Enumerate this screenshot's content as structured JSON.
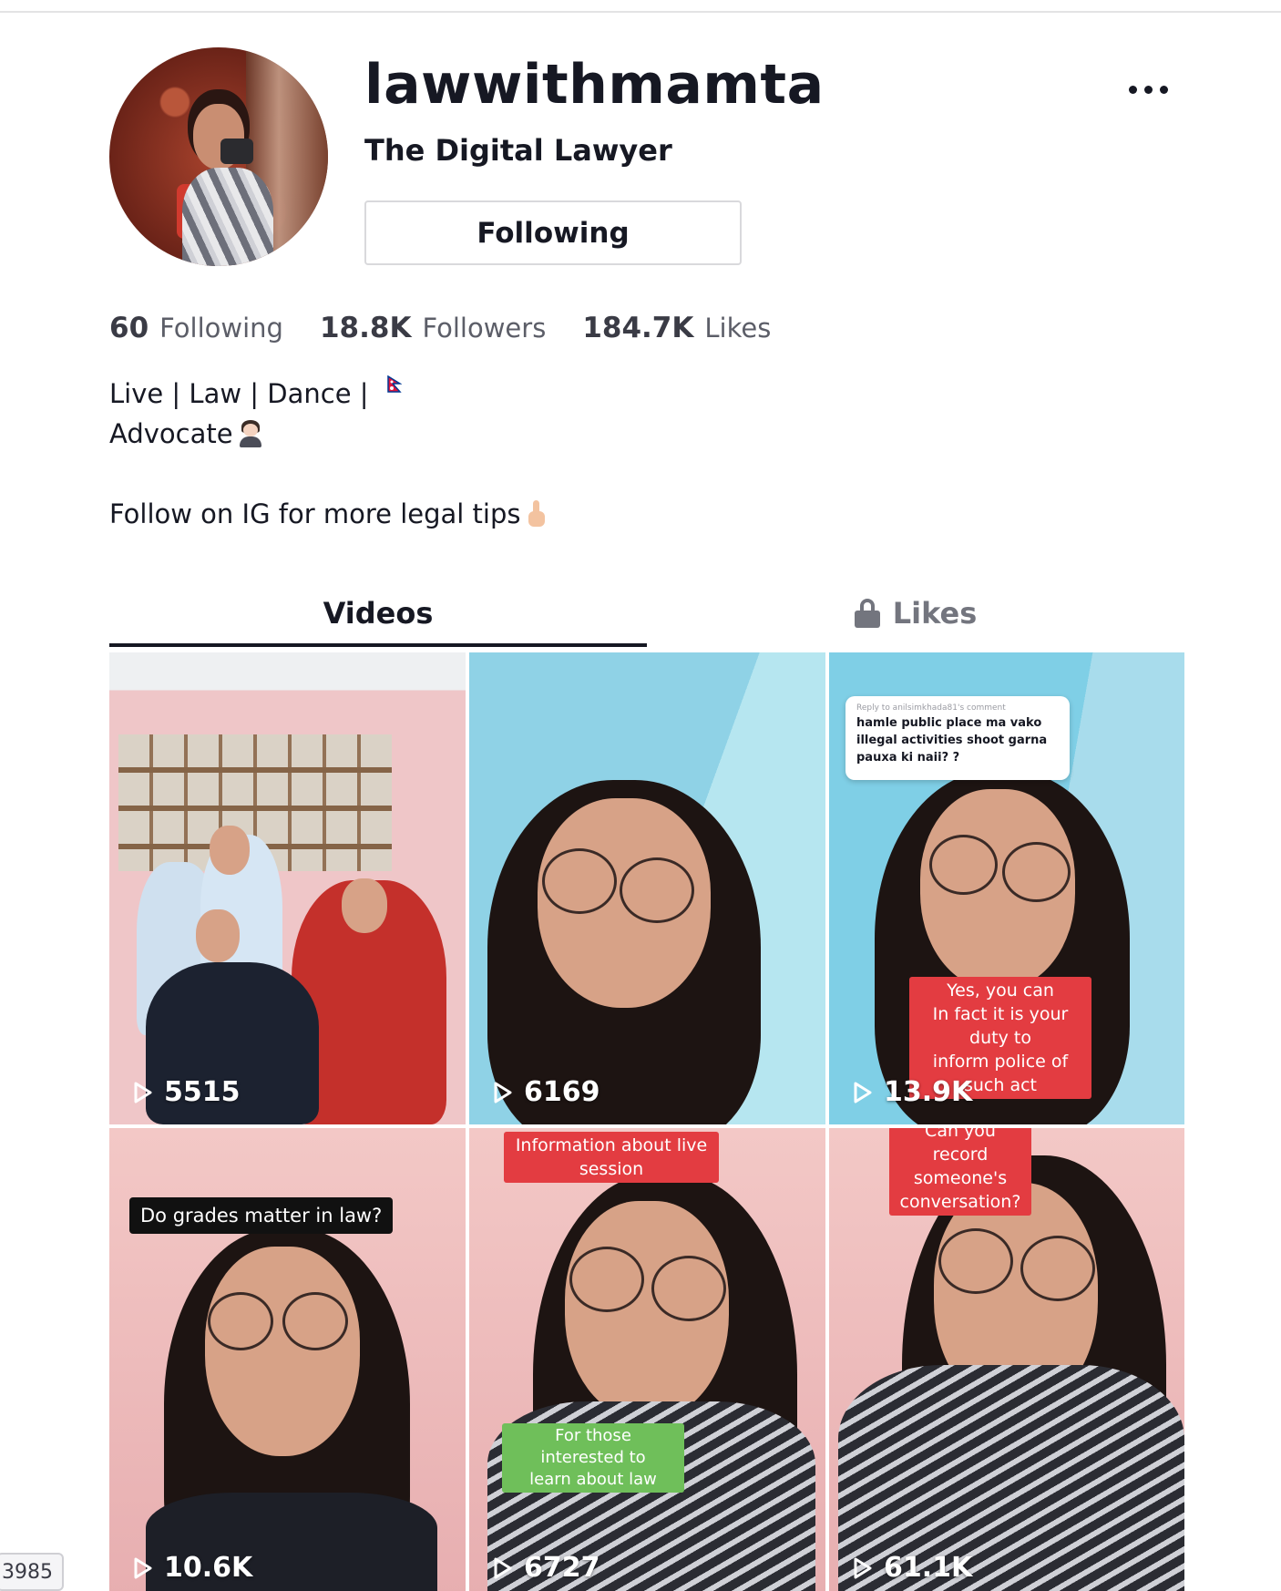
{
  "profile": {
    "username": "lawwithmamta",
    "nickname": "The Digital Lawyer",
    "follow_button": "Following",
    "more_icon": "ellipsis-icon"
  },
  "counts": {
    "following_num": "60",
    "following_label": "Following",
    "followers_num": "18.8K",
    "followers_label": "Followers",
    "likes_num": "184.7K",
    "likes_label": "Likes"
  },
  "bio": {
    "line1": "Live | Law | Dance |",
    "line2": "Advocate",
    "line3": "Follow on IG for more legal tips"
  },
  "tabs": {
    "videos": "Videos",
    "likes": "Likes"
  },
  "videos": [
    {
      "views": "5515"
    },
    {
      "views": "6169"
    },
    {
      "views": "13.9K",
      "comment_reply": "Reply to anilsimkhada81's comment",
      "comment_text": "hamle public place ma vako illegal activities shoot garna pauxa ki naii? ?",
      "caption_line1": "Yes, you can",
      "caption_line2": "In fact it is your duty to",
      "caption_line3": "inform police of such act"
    },
    {
      "views": "10.6K",
      "caption": "Do grades matter in law?"
    },
    {
      "views": "6727",
      "caption_top_line1": "Information about live",
      "caption_top_line2": "session",
      "caption_bottom_line1": "For those interested to",
      "caption_bottom_line2": "learn about law"
    },
    {
      "views": "61.1K",
      "caption_line1": "Can you record",
      "caption_line2": "someone's",
      "caption_line3": "conversation?"
    }
  ],
  "side_tag": "3985",
  "colors": {
    "text": "#161823",
    "muted": "#73757e",
    "caption_red": "#e33c41",
    "caption_green": "#6fbf5a"
  }
}
